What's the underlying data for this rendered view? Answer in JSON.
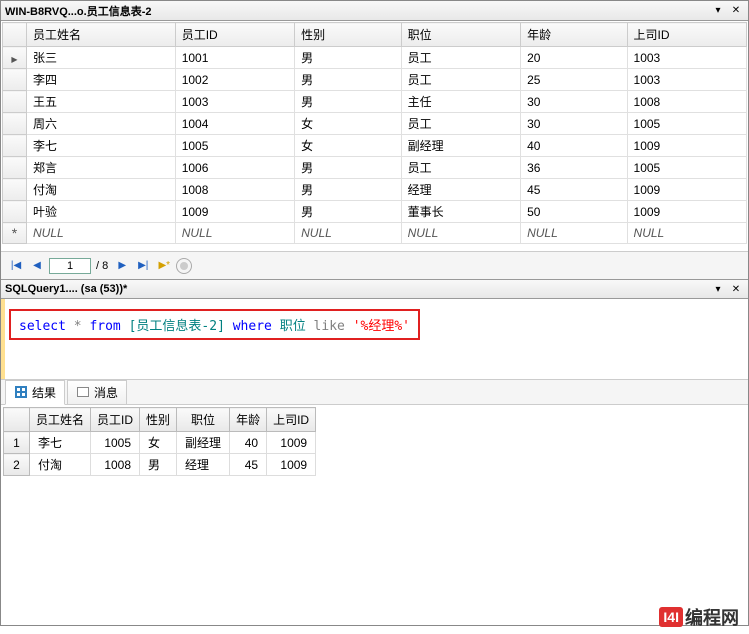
{
  "top_window": {
    "title": "WIN-B8RVQ...o.员工信息表-2"
  },
  "main_grid": {
    "headers": [
      "员工姓名",
      "员工ID",
      "性别",
      "职位",
      "年龄",
      "上司ID"
    ],
    "rows": [
      {
        "name": "张三",
        "id": "1001",
        "gender": "男",
        "position": "员工",
        "age": "20",
        "boss": "1003"
      },
      {
        "name": "李四",
        "id": "1002",
        "gender": "男",
        "position": "员工",
        "age": "25",
        "boss": "1003"
      },
      {
        "name": "王五",
        "id": "1003",
        "gender": "男",
        "position": "主任",
        "age": "30",
        "boss": "1008"
      },
      {
        "name": "周六",
        "id": "1004",
        "gender": "女",
        "position": "员工",
        "age": "30",
        "boss": "1005"
      },
      {
        "name": "李七",
        "id": "1005",
        "gender": "女",
        "position": "副经理",
        "age": "40",
        "boss": "1009"
      },
      {
        "name": "郑言",
        "id": "1006",
        "gender": "男",
        "position": "员工",
        "age": "36",
        "boss": "1005"
      },
      {
        "name": "付淘",
        "id": "1008",
        "gender": "男",
        "position": "经理",
        "age": "45",
        "boss": "1009"
      },
      {
        "name": "叶验",
        "id": "1009",
        "gender": "男",
        "position": "董事长",
        "age": "50",
        "boss": "1009"
      }
    ],
    "null_label": "NULL"
  },
  "nav": {
    "current": "1",
    "total": "/ 8"
  },
  "query_tab": {
    "title": "SQLQuery1.... (sa (53))*"
  },
  "sql": {
    "select": "select",
    "star": "*",
    "from": "from",
    "table": "[员工信息表-2]",
    "where": "where",
    "column": "职位",
    "like": "like",
    "pattern": "'%经理%'"
  },
  "tabs": {
    "results": "结果",
    "messages": "消息"
  },
  "results": {
    "headers": [
      "员工姓名",
      "员工ID",
      "性别",
      "职位",
      "年龄",
      "上司ID"
    ],
    "rows": [
      {
        "n": "1",
        "name": "李七",
        "id": "1005",
        "gender": "女",
        "position": "副经理",
        "age": "40",
        "boss": "1009"
      },
      {
        "n": "2",
        "name": "付淘",
        "id": "1008",
        "gender": "男",
        "position": "经理",
        "age": "45",
        "boss": "1009"
      }
    ]
  },
  "watermark": {
    "badge": "I4I",
    "text": "编程网"
  }
}
